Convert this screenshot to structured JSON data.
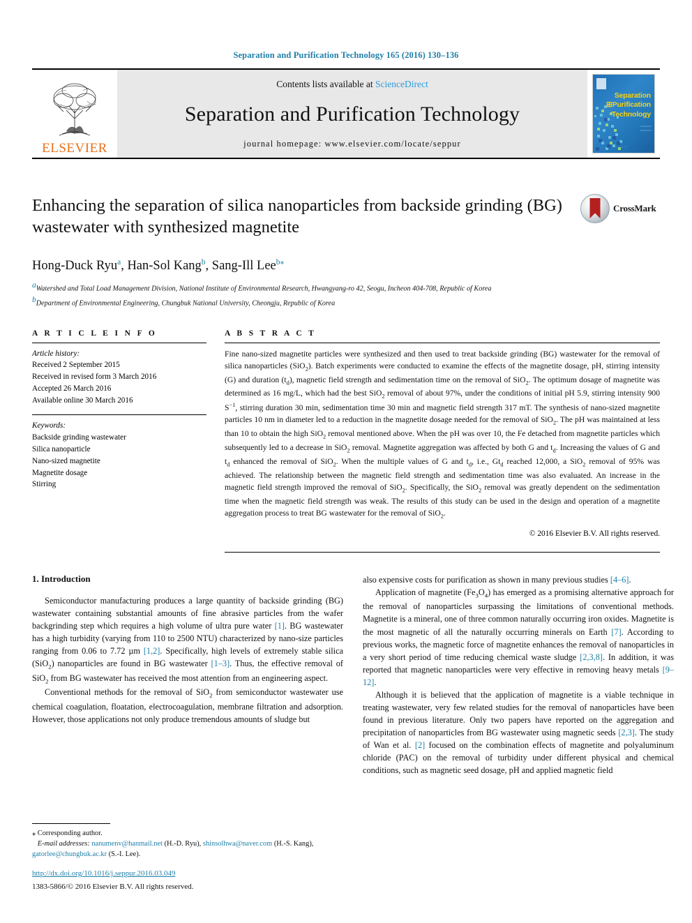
{
  "running_head": "Separation and Purification Technology 165 (2016) 130–136",
  "masthead": {
    "publisher_logo_text": "ELSEVIER",
    "contents_prefix": "Contents lists available at ",
    "contents_link": "ScienceDirect",
    "journal_name": "Separation and Purification Technology",
    "homepage": "journal homepage: www.elsevier.com/locate/seppur",
    "cover_title_line1": "Separation",
    "cover_title_line2": "⊞Purification",
    "cover_title_line3": "Technology"
  },
  "article": {
    "title": "Enhancing the separation of silica nanoparticles from backside grinding (BG) wastewater with synthesized magnetite",
    "crossmark_label": "CrossMark",
    "authors": [
      {
        "name": "Hong-Duck Ryu",
        "mark": "a"
      },
      {
        "name": "Han-Sol Kang",
        "mark": "b"
      },
      {
        "name": "Sang-Ill Lee",
        "mark": "b",
        "corresponding": "*"
      }
    ],
    "authors_line": "Hong-Duck Ryu a, Han-Sol Kang b, Sang-Ill Lee b*",
    "affiliations": [
      {
        "mark": "a",
        "text": "Watershed and Total Load Management Division, National Institute of Environmental Research, Hwangyang-ro 42, Seogu, Incheon 404-708, Republic of Korea"
      },
      {
        "mark": "b",
        "text": "Department of Environmental Engineering, Chungbuk National University, Cheongju, Republic of Korea"
      }
    ]
  },
  "info": {
    "heading": "A R T I C L E   I N F O",
    "history_label": "Article history:",
    "history": [
      "Received 2 September 2015",
      "Received in revised form 3 March 2016",
      "Accepted 26 March 2016",
      "Available online 30 March 2016"
    ],
    "keywords_label": "Keywords:",
    "keywords": [
      "Backside grinding wastewater",
      "Silica nanoparticle",
      "Nano-sized magnetite",
      "Magnetite dosage",
      "Stirring"
    ]
  },
  "abstract": {
    "heading": "A B S T R A C T",
    "text": "Fine nano-sized magnetite particles were synthesized and then used to treat backside grinding (BG) wastewater for the removal of silica nanoparticles (SiO2). Batch experiments were conducted to examine the effects of the magnetite dosage, pH, stirring intensity (G) and duration (td), magnetic field strength and sedimentation time on the removal of SiO2. The optimum dosage of magnetite was determined as 16 mg/L, which had the best SiO2 removal of about 97%, under the conditions of initial pH 5.9, stirring intensity 900 S−1, stirring duration 30 min, sedimentation time 30 min and magnetic field strength 317 mT. The synthesis of nano-sized magnetite particles 10 nm in diameter led to a reduction in the magnetite dosage needed for the removal of SiO2. The pH was maintained at less than 10 to obtain the high SiO2 removal mentioned above. When the pH was over 10, the Fe detached from magnetite particles which subsequently led to a decrease in SiO2 removal. Magnetite aggregation was affected by both G and td. Increasing the values of G and td enhanced the removal of SiO2. When the multiple values of G and td, i.e., Gtd reached 12,000, a SiO2 removal of 95% was achieved. The relationship between the magnetic field strength and sedimentation time was also evaluated. An increase in the magnetic field strength improved the removal of SiO2. Specifically, the SiO2 removal was greatly dependent on the sedimentation time when the magnetic field strength was weak. The results of this study can be used in the design and operation of a magnetite aggregation process to treat BG wastewater for the removal of SiO2.",
    "copyright": "© 2016 Elsevier B.V. All rights reserved."
  },
  "body": {
    "section_heading": "1. Introduction",
    "left_paragraphs": [
      "Semiconductor manufacturing produces a large quantity of backside grinding (BG) wastewater containing substantial amounts of fine abrasive particles from the wafer backgrinding step which requires a high volume of ultra pure water [1]. BG wastewater has a high turbidity (varying from 110 to 2500 NTU) characterized by nano-size particles ranging from 0.06 to 7.72 µm [1,2]. Specifically, high levels of extremely stable silica (SiO2) nanoparticles are found in BG wastewater [1–3]. Thus, the effective removal of SiO2 from BG wastewater has received the most attention from an engineering aspect.",
      "Conventional methods for the removal of SiO2 from semiconductor wastewater use chemical coagulation, floatation, electrocoagulation, membrane filtration and adsorption. However, those applications not only produce tremendous amounts of sludge but"
    ],
    "right_paragraphs": [
      "also expensive costs for purification as shown in many previous studies [4–6].",
      "Application of magnetite (Fe3O4) has emerged as a promising alternative approach for the removal of nanoparticles surpassing the limitations of conventional methods. Magnetite is a mineral, one of three common naturally occurring iron oxides. Magnetite is the most magnetic of all the naturally occurring minerals on Earth [7]. According to previous works, the magnetic force of magnetite enhances the removal of nanoparticles in a very short period of time reducing chemical waste sludge [2,3,8]. In addition, it was reported that magnetic nanoparticles were very effective in removing heavy metals [9–12].",
      "Although it is believed that the application of magnetite is a viable technique in treating wastewater, very few related studies for the removal of nanoparticles have been found in previous literature. Only two papers have reported on the aggregation and precipitation of nanoparticles from BG wastewater using magnetic seeds [2,3]. The study of Wan et al. [2] focused on the combination effects of magnetite and polyaluminum chloride (PAC) on the removal of turbidity under different physical and chemical conditions, such as magnetic seed dosage, pH and applied magnetic field"
    ]
  },
  "footnote": {
    "corresponding": "⁎ Corresponding author.",
    "email_label": "E-mail addresses:",
    "emails": [
      {
        "address": "nanumenv@hanmail.net",
        "owner": "(H.-D. Ryu)"
      },
      {
        "address": "shinsolhwa@naver.com",
        "owner": "(H.-S. Kang)"
      },
      {
        "address": "gatorlee@chungbuk.ac.kr",
        "owner": "(S.-I. Lee)."
      }
    ],
    "doi": "http://dx.doi.org/10.1016/j.seppur.2016.03.049",
    "issn": "1383-5866/© 2016 Elsevier B.V. All rights reserved."
  },
  "colors": {
    "link": "#1f7fa8",
    "elsevier_orange": "#e8711a",
    "sciencedirect": "#2b9cd8",
    "cover_blue": "#2176b8",
    "cover_yellow": "#f4d11a",
    "crossmark_red": "#b4201f"
  }
}
